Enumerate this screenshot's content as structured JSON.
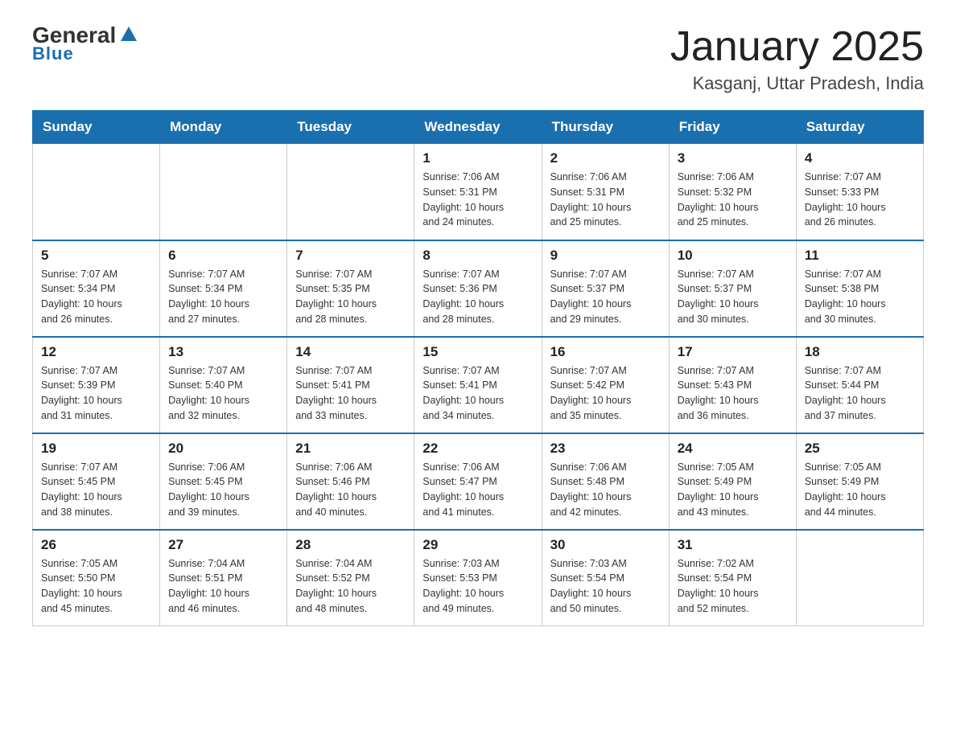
{
  "header": {
    "logo_general": "General",
    "logo_blue": "Blue",
    "title": "January 2025",
    "subtitle": "Kasganj, Uttar Pradesh, India"
  },
  "days_of_week": [
    "Sunday",
    "Monday",
    "Tuesday",
    "Wednesday",
    "Thursday",
    "Friday",
    "Saturday"
  ],
  "weeks": [
    [
      {
        "day": "",
        "info": ""
      },
      {
        "day": "",
        "info": ""
      },
      {
        "day": "",
        "info": ""
      },
      {
        "day": "1",
        "info": "Sunrise: 7:06 AM\nSunset: 5:31 PM\nDaylight: 10 hours\nand 24 minutes."
      },
      {
        "day": "2",
        "info": "Sunrise: 7:06 AM\nSunset: 5:31 PM\nDaylight: 10 hours\nand 25 minutes."
      },
      {
        "day": "3",
        "info": "Sunrise: 7:06 AM\nSunset: 5:32 PM\nDaylight: 10 hours\nand 25 minutes."
      },
      {
        "day": "4",
        "info": "Sunrise: 7:07 AM\nSunset: 5:33 PM\nDaylight: 10 hours\nand 26 minutes."
      }
    ],
    [
      {
        "day": "5",
        "info": "Sunrise: 7:07 AM\nSunset: 5:34 PM\nDaylight: 10 hours\nand 26 minutes."
      },
      {
        "day": "6",
        "info": "Sunrise: 7:07 AM\nSunset: 5:34 PM\nDaylight: 10 hours\nand 27 minutes."
      },
      {
        "day": "7",
        "info": "Sunrise: 7:07 AM\nSunset: 5:35 PM\nDaylight: 10 hours\nand 28 minutes."
      },
      {
        "day": "8",
        "info": "Sunrise: 7:07 AM\nSunset: 5:36 PM\nDaylight: 10 hours\nand 28 minutes."
      },
      {
        "day": "9",
        "info": "Sunrise: 7:07 AM\nSunset: 5:37 PM\nDaylight: 10 hours\nand 29 minutes."
      },
      {
        "day": "10",
        "info": "Sunrise: 7:07 AM\nSunset: 5:37 PM\nDaylight: 10 hours\nand 30 minutes."
      },
      {
        "day": "11",
        "info": "Sunrise: 7:07 AM\nSunset: 5:38 PM\nDaylight: 10 hours\nand 30 minutes."
      }
    ],
    [
      {
        "day": "12",
        "info": "Sunrise: 7:07 AM\nSunset: 5:39 PM\nDaylight: 10 hours\nand 31 minutes."
      },
      {
        "day": "13",
        "info": "Sunrise: 7:07 AM\nSunset: 5:40 PM\nDaylight: 10 hours\nand 32 minutes."
      },
      {
        "day": "14",
        "info": "Sunrise: 7:07 AM\nSunset: 5:41 PM\nDaylight: 10 hours\nand 33 minutes."
      },
      {
        "day": "15",
        "info": "Sunrise: 7:07 AM\nSunset: 5:41 PM\nDaylight: 10 hours\nand 34 minutes."
      },
      {
        "day": "16",
        "info": "Sunrise: 7:07 AM\nSunset: 5:42 PM\nDaylight: 10 hours\nand 35 minutes."
      },
      {
        "day": "17",
        "info": "Sunrise: 7:07 AM\nSunset: 5:43 PM\nDaylight: 10 hours\nand 36 minutes."
      },
      {
        "day": "18",
        "info": "Sunrise: 7:07 AM\nSunset: 5:44 PM\nDaylight: 10 hours\nand 37 minutes."
      }
    ],
    [
      {
        "day": "19",
        "info": "Sunrise: 7:07 AM\nSunset: 5:45 PM\nDaylight: 10 hours\nand 38 minutes."
      },
      {
        "day": "20",
        "info": "Sunrise: 7:06 AM\nSunset: 5:45 PM\nDaylight: 10 hours\nand 39 minutes."
      },
      {
        "day": "21",
        "info": "Sunrise: 7:06 AM\nSunset: 5:46 PM\nDaylight: 10 hours\nand 40 minutes."
      },
      {
        "day": "22",
        "info": "Sunrise: 7:06 AM\nSunset: 5:47 PM\nDaylight: 10 hours\nand 41 minutes."
      },
      {
        "day": "23",
        "info": "Sunrise: 7:06 AM\nSunset: 5:48 PM\nDaylight: 10 hours\nand 42 minutes."
      },
      {
        "day": "24",
        "info": "Sunrise: 7:05 AM\nSunset: 5:49 PM\nDaylight: 10 hours\nand 43 minutes."
      },
      {
        "day": "25",
        "info": "Sunrise: 7:05 AM\nSunset: 5:49 PM\nDaylight: 10 hours\nand 44 minutes."
      }
    ],
    [
      {
        "day": "26",
        "info": "Sunrise: 7:05 AM\nSunset: 5:50 PM\nDaylight: 10 hours\nand 45 minutes."
      },
      {
        "day": "27",
        "info": "Sunrise: 7:04 AM\nSunset: 5:51 PM\nDaylight: 10 hours\nand 46 minutes."
      },
      {
        "day": "28",
        "info": "Sunrise: 7:04 AM\nSunset: 5:52 PM\nDaylight: 10 hours\nand 48 minutes."
      },
      {
        "day": "29",
        "info": "Sunrise: 7:03 AM\nSunset: 5:53 PM\nDaylight: 10 hours\nand 49 minutes."
      },
      {
        "day": "30",
        "info": "Sunrise: 7:03 AM\nSunset: 5:54 PM\nDaylight: 10 hours\nand 50 minutes."
      },
      {
        "day": "31",
        "info": "Sunrise: 7:02 AM\nSunset: 5:54 PM\nDaylight: 10 hours\nand 52 minutes."
      },
      {
        "day": "",
        "info": ""
      }
    ]
  ]
}
